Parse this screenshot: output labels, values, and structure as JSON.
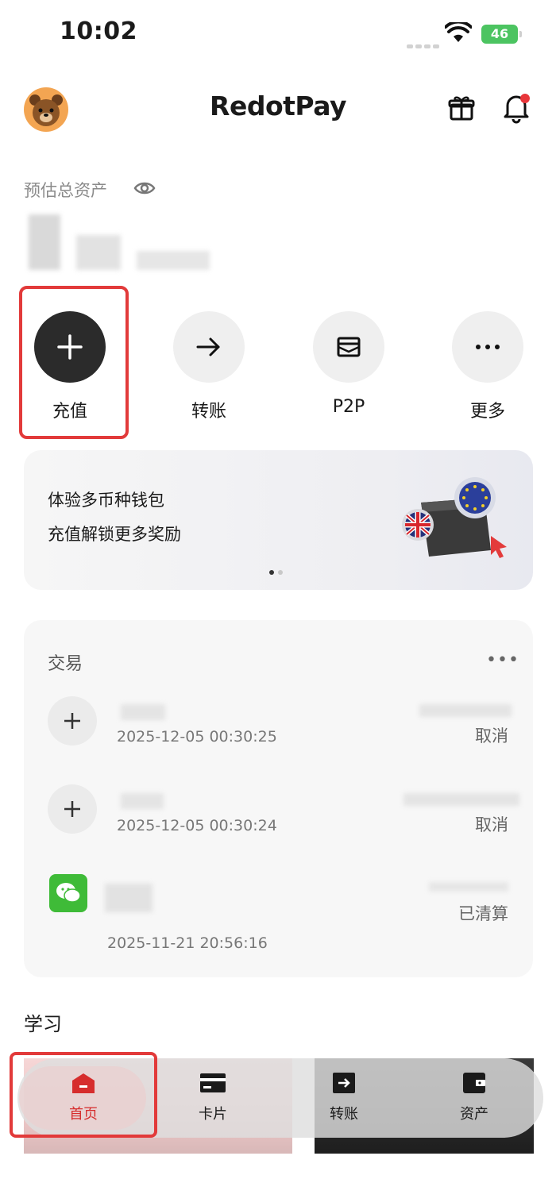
{
  "status_bar": {
    "time": "10:02",
    "battery": "46"
  },
  "header": {
    "brand": "RedotPay",
    "icons": [
      "avatar",
      "gift-icon",
      "bell-icon"
    ]
  },
  "assets": {
    "label": "预估总资产",
    "icon": "eye-icon"
  },
  "actions": [
    {
      "label": "充值",
      "icon": "plus-icon"
    },
    {
      "label": "转账",
      "icon": "arrow-right-icon"
    },
    {
      "label": "P2P",
      "icon": "envelope-icon"
    },
    {
      "label": "更多",
      "icon": "more-icon"
    }
  ],
  "promo": {
    "title": "体验多币种钱包",
    "subtitle": "充值解锁更多奖励",
    "pages": 2,
    "active_page": 1
  },
  "transactions": {
    "title": "交易",
    "items": [
      {
        "icon": "plus-icon",
        "date": "2025-12-05 00:30:25",
        "status": "取消"
      },
      {
        "icon": "plus-icon",
        "date": "2025-12-05 00:30:24",
        "status": "取消"
      },
      {
        "icon": "wechat-icon",
        "date": "2025-11-21 20:56:16",
        "status": "已清算"
      }
    ]
  },
  "learn": {
    "title": "学习"
  },
  "tabbar": {
    "tabs": [
      {
        "label": "首页",
        "icon": "home-icon",
        "active": true
      },
      {
        "label": "卡片",
        "icon": "card-icon",
        "active": false
      },
      {
        "label": "转账",
        "icon": "transfer-icon",
        "active": false
      },
      {
        "label": "资产",
        "icon": "wallet-icon",
        "active": false
      }
    ]
  },
  "colors": {
    "accent_red": "#e23a3a",
    "dark_button": "#2b2b2b",
    "wechat_green": "#3fbb38",
    "battery_green": "#4cc461"
  }
}
